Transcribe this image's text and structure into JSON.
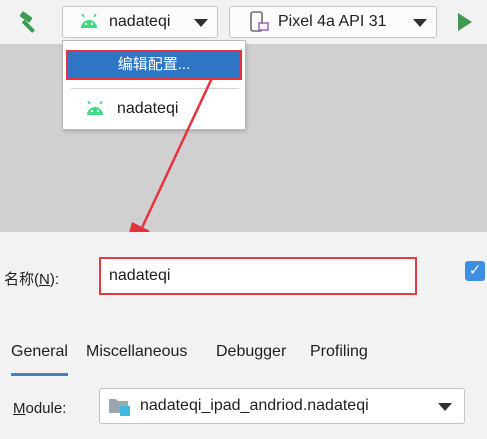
{
  "toolbar": {
    "run_config": "nadateqi",
    "device": "Pixel 4a API 31"
  },
  "popup": {
    "edit_item": "编辑配置...",
    "config_item": "nadateqi"
  },
  "form": {
    "name_label_prefix": "名称(",
    "name_label_mnemonic": "N",
    "name_label_suffix": "):",
    "name_value": "nadateqi",
    "tabs": [
      "General",
      "Miscellaneous",
      "Debugger",
      "Profiling"
    ],
    "module_label_mnemonic": "M",
    "module_label_rest": "odule:",
    "module_value": "nadateqi_ipad_andriod.nadateqi"
  },
  "colors": {
    "accent": "#2f75c6",
    "highlight_border": "#e5323d",
    "android_green": "#3ddc84",
    "run_green": "#3d9a50"
  }
}
